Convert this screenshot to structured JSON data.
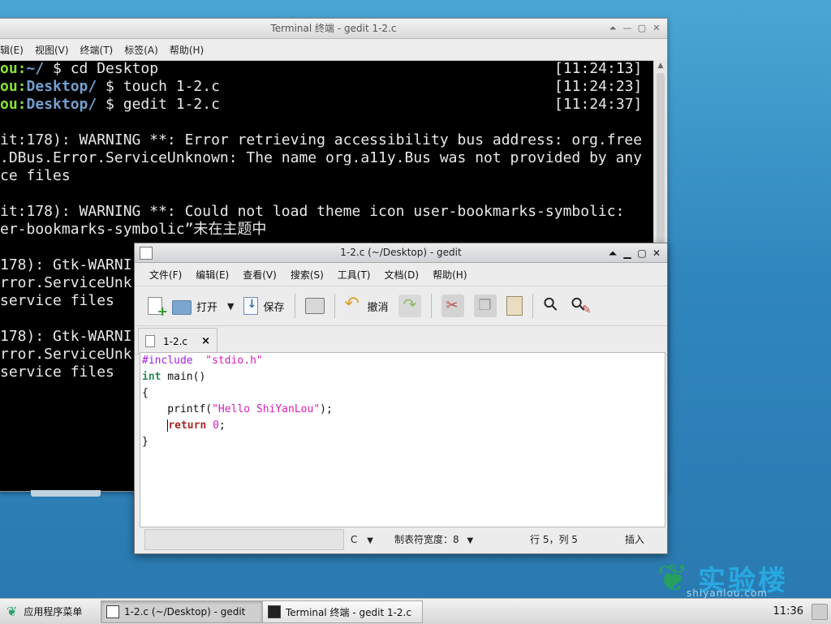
{
  "terminal": {
    "title": "Terminal 终端 - gedit 1-2.c",
    "menu": [
      "辑(E)",
      "视图(V)",
      "终端(T)",
      "标签(A)",
      "帮助(H)"
    ],
    "prompts": [
      {
        "user": "ou:",
        "path": "~/",
        "cmd": " $ cd Desktop",
        "time": "[11:24:13]"
      },
      {
        "user": "ou:",
        "path": "Desktop/",
        "cmd": " $ touch 1-2.c",
        "time": "[11:24:23]"
      },
      {
        "user": "ou:",
        "path": "Desktop/",
        "cmd": " $ gedit 1-2.c",
        "time": "[11:24:37]"
      }
    ],
    "output": [
      "",
      "it:178): WARNING **: Error retrieving accessibility bus address: org.free",
      ".DBus.Error.ServiceUnknown: The name org.a11y.Bus was not provided by any",
      "ce files",
      "",
      "it:178): WARNING **: Could not load theme icon user-bookmarks-symbolic:",
      "er-bookmarks-symbolic”未在主题中",
      "",
      "178): Gtk-WARNI",
      "rror.ServiceUnk",
      "service files",
      "",
      "178): Gtk-WARNI",
      "rror.ServiceUnk",
      "service files"
    ]
  },
  "gedit": {
    "title": "1-2.c (~/Desktop) - gedit",
    "menu": [
      "文件(F)",
      "编辑(E)",
      "查看(V)",
      "搜索(S)",
      "工具(T)",
      "文档(D)",
      "帮助(H)"
    ],
    "toolbar": {
      "open": "打开",
      "save": "保存",
      "undo": "撤消"
    },
    "tab": {
      "label": "1-2.c",
      "close": "×"
    },
    "code": {
      "l1_pre": "#include",
      "l1_str": "\"stdio.h\"",
      "l2_type": "int",
      "l2_rest": " main()",
      "l3": "{",
      "l4_pre": "    printf(",
      "l4_str": "\"Hello ShiYanLou\"",
      "l4_post": ");",
      "l5_kw": "return",
      "l5_num": "0",
      "l5_post": ";",
      "l6": "}"
    },
    "status": {
      "language": "C",
      "tab_width": "制表符宽度：8",
      "position": "行 5，列 5",
      "mode": "插入"
    }
  },
  "taskbar": {
    "app_menu": "应用程序菜单",
    "items": [
      "1-2.c (~/Desktop) - gedit",
      "Terminal 终端 - gedit 1-2.c"
    ],
    "clock": "11:36"
  },
  "watermark": {
    "brand": "实验楼",
    "url": "shiyanlou.com"
  }
}
